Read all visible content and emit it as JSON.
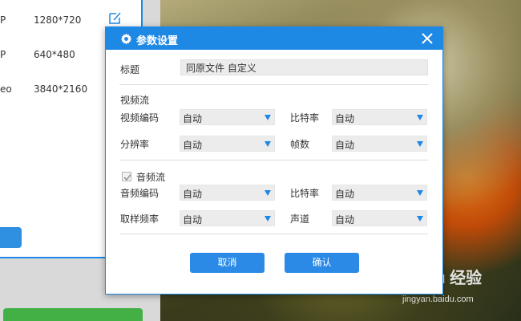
{
  "background": {
    "rows": [
      {
        "format": "P",
        "resolution": "1280*720"
      },
      {
        "format": "P",
        "resolution": "640*480"
      },
      {
        "format": "eo",
        "resolution": "3840*2160"
      }
    ]
  },
  "dialog": {
    "title": "参数设置",
    "title_label": "标题",
    "title_value": "同原文件 自定义",
    "video": {
      "section": "视频流",
      "encoder_label": "视频编码",
      "encoder_value": "自动",
      "bitrate_label": "比特率",
      "bitrate_value": "自动",
      "resolution_label": "分辨率",
      "resolution_value": "自动",
      "fps_label": "帧数",
      "fps_value": "自动"
    },
    "audio": {
      "section": "音频流",
      "checked": true,
      "encoder_label": "音频编码",
      "encoder_value": "自动",
      "bitrate_label": "比特率",
      "bitrate_value": "自动",
      "samplerate_label": "取样频率",
      "samplerate_value": "自动",
      "channels_label": "声道",
      "channels_value": "自动"
    },
    "buttons": {
      "cancel": "取消",
      "confirm": "确认"
    }
  },
  "watermark": {
    "main": "Baidu 经验",
    "sub": "jingyan.baidu.com"
  },
  "colors": {
    "accent": "#1e88e5",
    "button": "#2a8ae6",
    "green": "#43b046"
  }
}
